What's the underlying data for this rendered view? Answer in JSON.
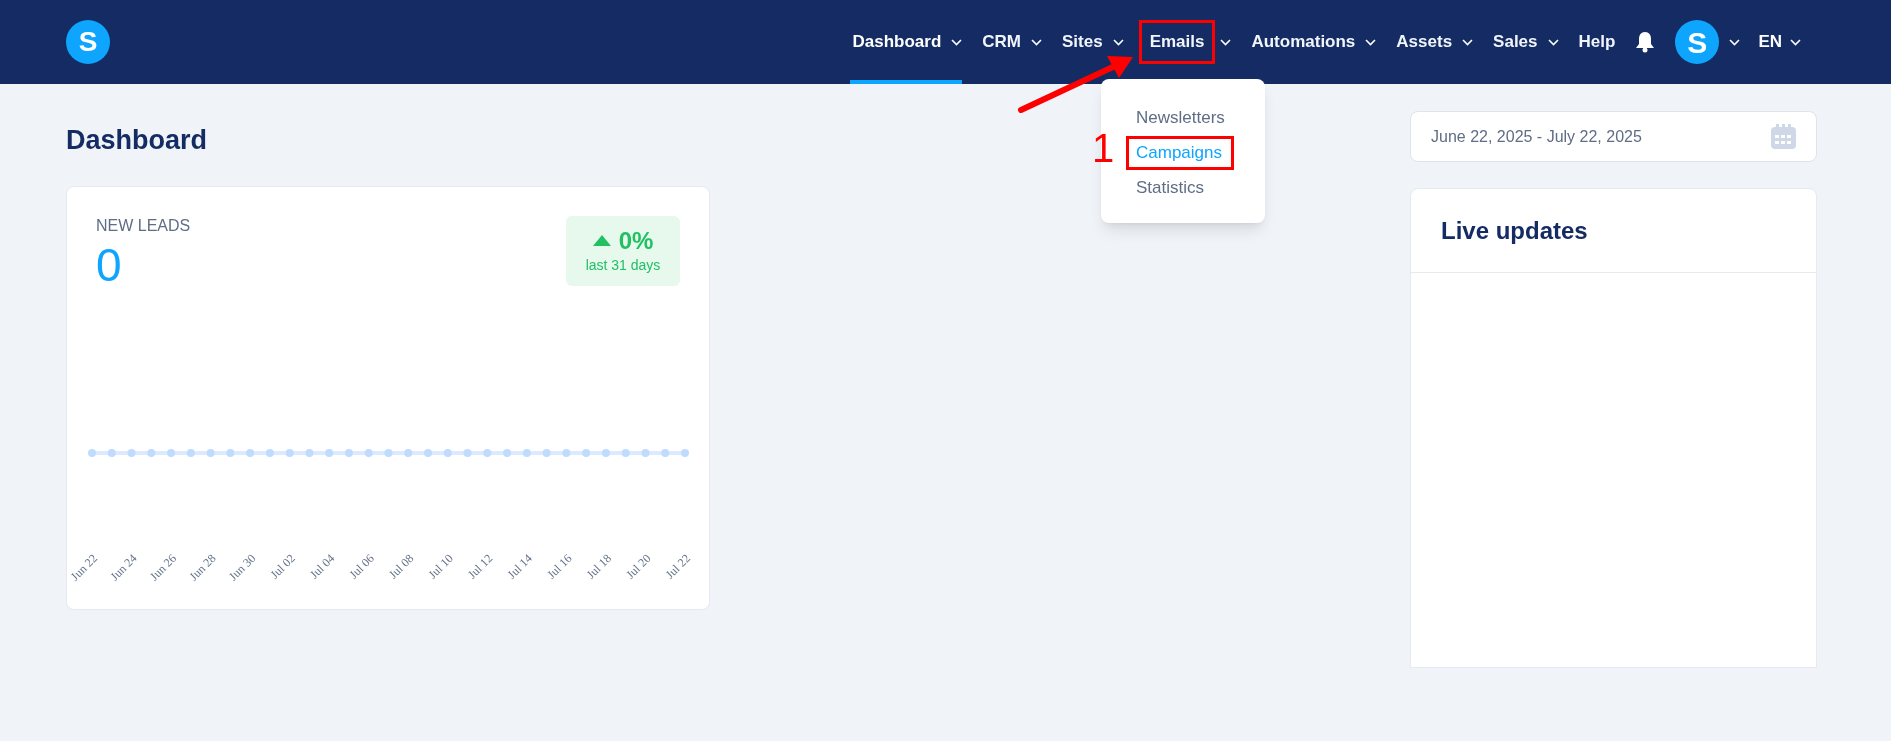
{
  "nav": {
    "items": [
      {
        "label": "Dashboard",
        "caret": true,
        "selected": true,
        "highlighted": false
      },
      {
        "label": "CRM",
        "caret": true,
        "selected": false,
        "highlighted": false
      },
      {
        "label": "Sites",
        "caret": true,
        "selected": false,
        "highlighted": false
      },
      {
        "label": "Emails",
        "caret": true,
        "selected": false,
        "highlighted": true
      },
      {
        "label": "Automations",
        "caret": true,
        "selected": false,
        "highlighted": false
      },
      {
        "label": "Assets",
        "caret": true,
        "selected": false,
        "highlighted": false
      },
      {
        "label": "Sales",
        "caret": true,
        "selected": false,
        "highlighted": false
      },
      {
        "label": "Help",
        "caret": false,
        "selected": false,
        "highlighted": false
      }
    ],
    "avatar_letter": "S",
    "logo_letter": "S",
    "language": "EN"
  },
  "dropdown": {
    "items": [
      {
        "label": "Newsletters",
        "selected": false,
        "highlighted": false
      },
      {
        "label": "Campaigns",
        "selected": true,
        "highlighted": true
      },
      {
        "label": "Statistics",
        "selected": false,
        "highlighted": false
      }
    ]
  },
  "annotation": {
    "step_label": "1"
  },
  "page_title": "Dashboard",
  "date_range": "June 22, 2025 - July 22, 2025",
  "leads_card": {
    "title": "NEW LEADS",
    "count": "0",
    "change": "0%",
    "change_period": "last 31 days",
    "x_labels": [
      "Jun 22",
      "Jun 24",
      "Jun 26",
      "Jun 28",
      "Jun 30",
      "Jul 02",
      "Jul 04",
      "Jul 06",
      "Jul 08",
      "Jul 10",
      "Jul 12",
      "Jul 14",
      "Jul 16",
      "Jul 18",
      "Jul 20",
      "Jul 22"
    ]
  },
  "live_updates": {
    "title": "Live updates"
  }
}
